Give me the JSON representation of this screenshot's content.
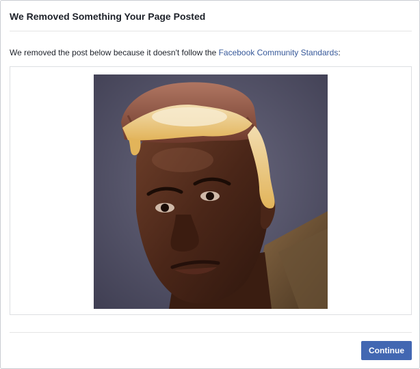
{
  "dialog": {
    "title": "We Removed Something Your Page Posted",
    "message_prefix": "We removed the post below because it doesn't follow the ",
    "standards_link": "Facebook Community Standards",
    "message_suffix": ":",
    "continue_label": "Continue"
  },
  "colors": {
    "link": "#365899",
    "button": "#4267b2",
    "title_text": "#1d2129",
    "border": "#dddfe2"
  },
  "post_image": {
    "subject": "man-with-melted-chocolate-candy-bar-head-photo"
  }
}
